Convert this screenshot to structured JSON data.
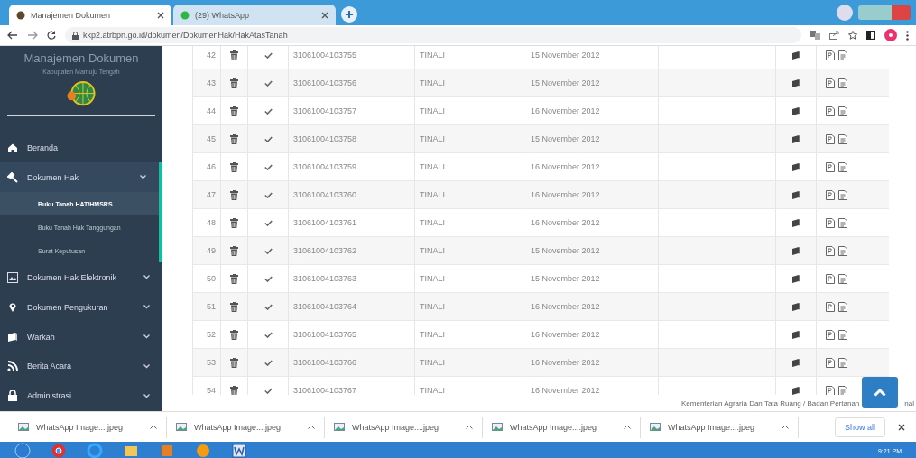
{
  "browser": {
    "tabs": [
      {
        "title": "Manajemen Dokumen",
        "selected": true
      },
      {
        "title": "(29) WhatsApp",
        "selected": false
      }
    ],
    "url": "kkp2.atrbpn.go.id/dokumen/DokumenHak/HakAtasTanah"
  },
  "sidebar": {
    "title": "Manajemen Dokumen",
    "subtitle": "Kabupaten Mamuju Tengah",
    "items": [
      {
        "label": "Beranda"
      },
      {
        "label": "Dokumen Hak",
        "expanded": true,
        "children": [
          {
            "label": "Buku Tanah HAT/HMSRS",
            "selected": true
          },
          {
            "label": "Buku Tanah Hak Tanggungan",
            "selected": false
          },
          {
            "label": "Surat Keputusan",
            "selected": false
          }
        ]
      },
      {
        "label": "Dokumen Hak Elektronik",
        "expanded": false
      },
      {
        "label": "Dokumen Pengukuran",
        "expanded": false
      },
      {
        "label": "Warkah",
        "expanded": false
      },
      {
        "label": "Berita Acara",
        "expanded": false
      },
      {
        "label": "Administrasi",
        "expanded": false
      }
    ]
  },
  "table": {
    "rows": [
      {
        "no": "42",
        "checked": true,
        "number": "31061004103755",
        "village": "TINALI",
        "date": "15 November 2012"
      },
      {
        "no": "43",
        "checked": true,
        "number": "31061004103756",
        "village": "TINALI",
        "date": "15 November 2012"
      },
      {
        "no": "44",
        "checked": true,
        "number": "31061004103757",
        "village": "TINALI",
        "date": "16 November 2012"
      },
      {
        "no": "45",
        "checked": true,
        "number": "31061004103758",
        "village": "TINALI",
        "date": "15 November 2012"
      },
      {
        "no": "46",
        "checked": true,
        "number": "31061004103759",
        "village": "TINALI",
        "date": "16 November 2012"
      },
      {
        "no": "47",
        "checked": true,
        "number": "31061004103760",
        "village": "TINALI",
        "date": "16 November 2012"
      },
      {
        "no": "48",
        "checked": true,
        "number": "31061004103761",
        "village": "TINALI",
        "date": "16 November 2012"
      },
      {
        "no": "49",
        "checked": true,
        "number": "31061004103762",
        "village": "TINALI",
        "date": "15 November 2012"
      },
      {
        "no": "50",
        "checked": true,
        "number": "31061004103763",
        "village": "TINALI",
        "date": "15 November 2012"
      },
      {
        "no": "51",
        "checked": true,
        "number": "31061004103764",
        "village": "TINALI",
        "date": "16 November 2012"
      },
      {
        "no": "52",
        "checked": true,
        "number": "31061004103765",
        "village": "TINALI",
        "date": "16 November 2012"
      },
      {
        "no": "53",
        "checked": true,
        "number": "31061004103766",
        "village": "TINALI",
        "date": "16 November 2012"
      },
      {
        "no": "54",
        "checked": true,
        "number": "31061004103767",
        "village": "TINALI",
        "date": "16 November 2012"
      }
    ]
  },
  "footer": {
    "text_before": "Kementerian Agraria Dan Tata Ruang / Badan Pertanah",
    "text_after": "nal"
  },
  "downloads": {
    "items": [
      "WhatsApp Image....jpeg",
      "WhatsApp Image....jpeg",
      "WhatsApp Image....jpeg",
      "WhatsApp Image....jpeg",
      "WhatsApp Image....jpeg"
    ],
    "show_all": "Show all"
  },
  "taskbar": {
    "time": "9:21 PM"
  }
}
